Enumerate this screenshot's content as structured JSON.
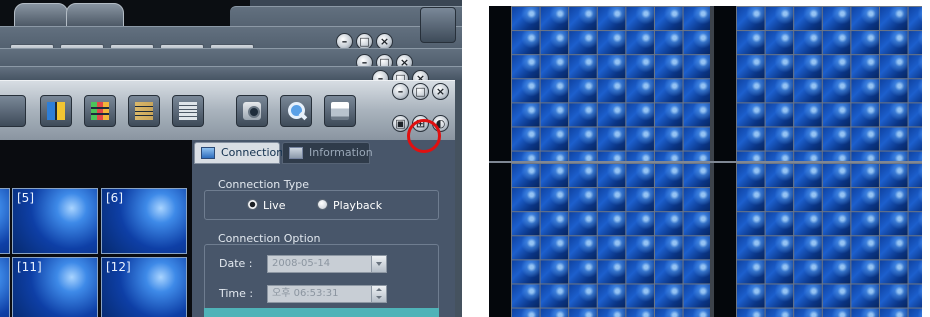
{
  "connection_panel": {
    "tabs": [
      {
        "label": "Connection",
        "active": true
      },
      {
        "label": "Information",
        "active": false
      }
    ],
    "connection_type_label": "Connection Type",
    "radio_live": "Live",
    "radio_playback": "Playback",
    "selected_mode": "Live",
    "connection_option_label": "Connection Option",
    "date_label": "Date :",
    "date_value": "2008-05-14",
    "time_label": "Time :",
    "time_value": "오후 06:53:31"
  },
  "video_grid": {
    "channels": [
      "[5]",
      "[6]",
      "[11]",
      "[12]"
    ]
  },
  "toolbar": {
    "buttons": [
      "layout-2x2-icon",
      "layout-3x3-icon",
      "layout-4x4-icon",
      "layout-5x5-icon",
      "snapshot-camera-icon",
      "search-icon",
      "print-icon"
    ]
  },
  "window_controls": [
    "minimize-icon",
    "maximize-icon",
    "close-icon"
  ],
  "highlight": {
    "color": "#e01010",
    "target": "grid-layout-button"
  },
  "right_view": {
    "layout": "4 quadrants of 7x13 camera tiles"
  }
}
